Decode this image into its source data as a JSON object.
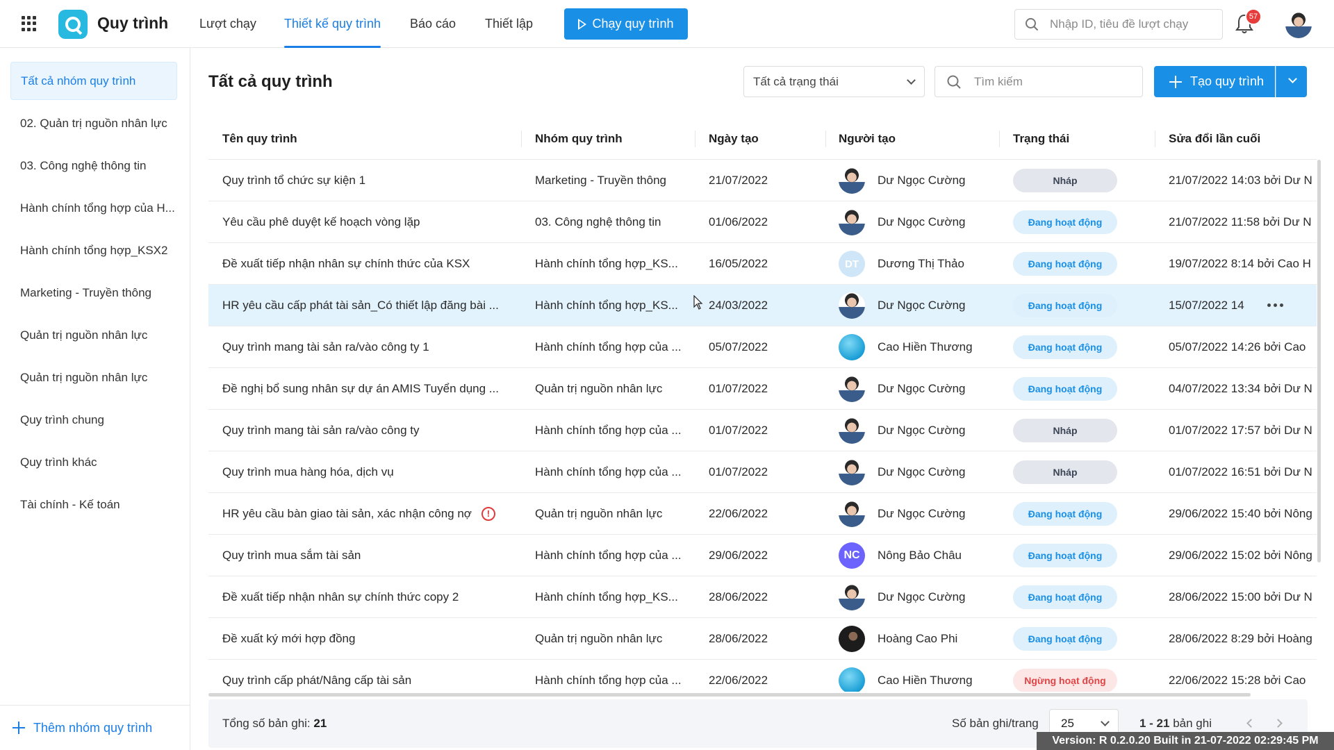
{
  "app": {
    "name": "Quy trình"
  },
  "nav": {
    "tabs": [
      {
        "label": "Lượt chạy"
      },
      {
        "label": "Thiết kế quy trình"
      },
      {
        "label": "Báo cáo"
      },
      {
        "label": "Thiết lập"
      }
    ],
    "active_tab": "Thiết kế quy trình",
    "run_button": "Chạy quy trình",
    "search_placeholder": "Nhập ID, tiêu đề lượt chạy",
    "notification_count": "57"
  },
  "sidebar": {
    "items": [
      {
        "label": "Tất cả nhóm quy trình"
      },
      {
        "label": "02. Quản trị nguồn nhân lực"
      },
      {
        "label": "03. Công nghệ thông tin"
      },
      {
        "label": "Hành chính tổng hợp của H..."
      },
      {
        "label": "Hành chính tổng hợp_KSX2"
      },
      {
        "label": "Marketing - Truyền thông"
      },
      {
        "label": "Quản trị nguồn nhân lực"
      },
      {
        "label": "Quản trị nguồn nhân lực"
      },
      {
        "label": "Quy trình chung"
      },
      {
        "label": "Quy trình khác"
      },
      {
        "label": "Tài chính - Kế toán"
      }
    ],
    "add_button": "Thêm nhóm quy trình"
  },
  "main": {
    "title": "Tất cả quy trình",
    "status_filter": "Tất cả trạng thái",
    "search_placeholder": "Tìm kiếm",
    "create_button": "Tạo quy trình"
  },
  "table": {
    "columns": [
      "Tên quy trình",
      "Nhóm quy trình",
      "Ngày tạo",
      "Người tạo",
      "Trạng thái",
      "Sửa đổi lần cuối"
    ],
    "rows": [
      {
        "name": "Quy trình tổ chức sự kiện 1",
        "group": "Marketing - Truyền thông",
        "date": "21/07/2022",
        "creator": "Dư Ngọc Cường",
        "avatar": "photo",
        "status": "Nháp",
        "status_kind": "draft",
        "modified": "21/07/2022 14:03 bởi Dư N"
      },
      {
        "name": "Yêu cầu phê duyệt kế hoạch vòng lặp",
        "group": "03. Công nghệ thông tin",
        "date": "01/06/2022",
        "creator": "Dư Ngọc Cường",
        "avatar": "photo",
        "status": "Đang hoạt động",
        "status_kind": "active",
        "modified": "21/07/2022 11:58 bởi Dư N"
      },
      {
        "name": "Đề xuất tiếp nhận nhân sự chính thức của KSX",
        "group": "Hành chính tổng hợp_KS...",
        "date": "16/05/2022",
        "creator": "Dương Thị Thảo",
        "avatar": "DT",
        "status": "Đang hoạt động",
        "status_kind": "active",
        "modified": "19/07/2022 8:14 bởi Cao H"
      },
      {
        "name": "HR yêu cầu cấp phát tài sản_Có thiết lập đăng bài ...",
        "group": "Hành chính tổng hợp_KS...",
        "date": "24/03/2022",
        "creator": "Dư Ngọc Cường",
        "avatar": "photo",
        "status": "Đang hoạt động",
        "status_kind": "active",
        "modified": "15/07/2022 14",
        "hover": true
      },
      {
        "name": "Quy trình mang tài sản ra/vào công ty 1",
        "group": "Hành chính tổng hợp của ...",
        "date": "05/07/2022",
        "creator": "Cao Hiền Thương",
        "avatar": "sky",
        "status": "Đang hoạt động",
        "status_kind": "active",
        "modified": "05/07/2022 14:26 bởi Cao"
      },
      {
        "name": "Đề nghị bổ sung nhân sự dự án AMIS Tuyển dụng ...",
        "group": "Quản trị nguồn nhân lực",
        "date": "01/07/2022",
        "creator": "Dư Ngọc Cường",
        "avatar": "photo",
        "status": "Đang hoạt động",
        "status_kind": "active",
        "modified": "04/07/2022 13:34 bởi Dư N"
      },
      {
        "name": "Quy trình mang tài sản ra/vào công ty",
        "group": "Hành chính tổng hợp của ...",
        "date": "01/07/2022",
        "creator": "Dư Ngọc Cường",
        "avatar": "photo",
        "status": "Nháp",
        "status_kind": "draft",
        "modified": "01/07/2022 17:57 bởi Dư N"
      },
      {
        "name": "Quy trình mua hàng hóa, dịch vụ",
        "group": "Hành chính tổng hợp của ...",
        "date": "01/07/2022",
        "creator": "Dư Ngọc Cường",
        "avatar": "photo",
        "status": "Nháp",
        "status_kind": "draft",
        "modified": "01/07/2022 16:51 bởi Dư N"
      },
      {
        "name": "HR yêu cầu bàn giao tài sản, xác nhận công nợ",
        "group": "Quản trị nguồn nhân lực",
        "date": "22/06/2022",
        "creator": "Dư Ngọc Cường",
        "avatar": "photo",
        "status": "Đang hoạt động",
        "status_kind": "active",
        "modified": "29/06/2022 15:40 bởi Nông",
        "warning": true
      },
      {
        "name": "Quy trình mua sắm tài sản",
        "group": "Hành chính tổng hợp của ...",
        "date": "29/06/2022",
        "creator": "Nông Bảo Châu",
        "avatar": "NC",
        "status": "Đang hoạt động",
        "status_kind": "active",
        "modified": "29/06/2022 15:02 bởi Nông"
      },
      {
        "name": "Đề xuất tiếp nhận nhân sự chính thức copy 2",
        "group": "Hành chính tổng hợp_KS...",
        "date": "28/06/2022",
        "creator": "Dư Ngọc Cường",
        "avatar": "photo",
        "status": "Đang hoạt động",
        "status_kind": "active",
        "modified": "28/06/2022 15:00 bởi Dư N"
      },
      {
        "name": "Đề xuất ký mới hợp đồng",
        "group": "Quản trị nguồn nhân lực",
        "date": "28/06/2022",
        "creator": "Hoàng Cao Phi",
        "avatar": "dark",
        "status": "Đang hoạt động",
        "status_kind": "active",
        "modified": "28/06/2022 8:29 bởi Hoàng"
      },
      {
        "name": "Quy trình cấp phát/Nâng cấp tài sản",
        "group": "Hành chính tổng hợp của ...",
        "date": "22/06/2022",
        "creator": "Cao Hiền Thương",
        "avatar": "sky",
        "status": "Ngừng hoạt động",
        "status_kind": "stopped",
        "modified": "22/06/2022 15:28 bởi Cao"
      }
    ]
  },
  "footer": {
    "total_label": "Tổng số bản ghi:",
    "total_value": "21",
    "per_page_label": "Số bản ghi/trang",
    "per_page_value": "25",
    "range_bold": "1 - 21",
    "range_suffix": "bản ghi"
  },
  "version": "Version: R 0.2.0.20 Built in 21-07-2022 02:29:45 PM"
}
